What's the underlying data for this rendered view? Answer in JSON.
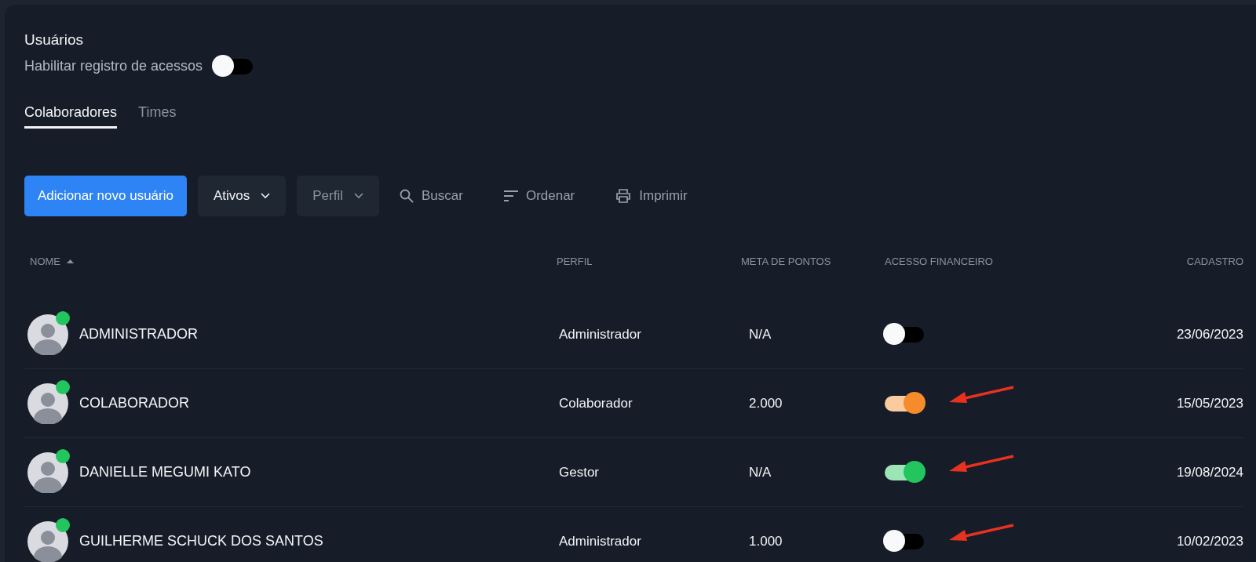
{
  "title": "Usuários",
  "access_log": {
    "label": "Habilitar registro de acessos",
    "on": false
  },
  "tabs": [
    {
      "label": "Colaboradores",
      "selected": true
    },
    {
      "label": "Times",
      "selected": false
    }
  ],
  "toolbar": {
    "add_button": "Adicionar novo usuário",
    "filters": [
      {
        "label": "Ativos",
        "disabled": false
      },
      {
        "label": "Perfil",
        "disabled": true
      }
    ],
    "actions": [
      {
        "kind": "search",
        "label": "Buscar"
      },
      {
        "kind": "sort",
        "label": "Ordenar"
      },
      {
        "kind": "print",
        "label": "Imprimir"
      }
    ]
  },
  "table": {
    "columns": [
      "NOME",
      "PERFIL",
      "META DE PONTOS",
      "ACESSO FINANCEIRO",
      "CADASTRO"
    ],
    "rows": [
      {
        "name": "ADMINISTRADOR",
        "online": true,
        "profile": "Administrador",
        "points_goal": "N/A",
        "financial_access": {
          "on": false
        },
        "arrow": false,
        "created": "23/06/2023"
      },
      {
        "name": "COLABORADOR",
        "online": true,
        "profile": "Colaborador",
        "points_goal": "2.000",
        "financial_access": {
          "on": true,
          "color": "#f68b2c"
        },
        "arrow": true,
        "created": "15/05/2023"
      },
      {
        "name": "DANIELLE MEGUMI KATO",
        "online": true,
        "profile": "Gestor",
        "points_goal": "N/A",
        "financial_access": {
          "on": true,
          "color": "#22c55e"
        },
        "arrow": true,
        "created": "19/08/2024"
      },
      {
        "name": "GUILHERME SCHUCK DOS SANTOS",
        "online": true,
        "profile": "Administrador",
        "points_goal": "1.000",
        "financial_access": {
          "on": false
        },
        "arrow": true,
        "created": "10/02/2023"
      }
    ]
  }
}
